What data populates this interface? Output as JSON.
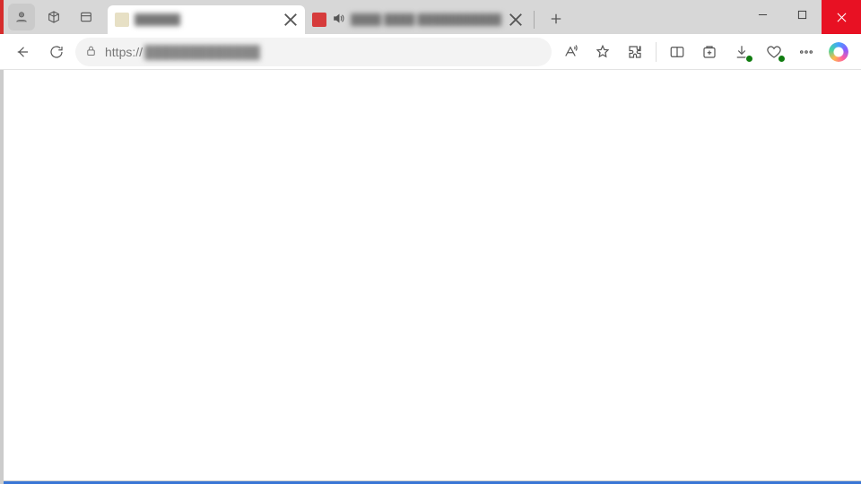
{
  "tabs": [
    {
      "title": "██████",
      "favicon_color": "#e7e0c5",
      "active": true,
      "has_audio": false
    },
    {
      "title": "████ ████ ███████████",
      "favicon_color": "#d63b3b",
      "active": false,
      "has_audio": true
    }
  ],
  "address_bar": {
    "scheme": "https://",
    "rest": "█████████████"
  },
  "window_controls": {
    "minimize": "Minimize",
    "maximize": "Maximize",
    "close": "Close"
  },
  "toolbar": {
    "back": "Back",
    "refresh": "Refresh",
    "read_aloud": "Read aloud",
    "favorite": "Add to favorites",
    "extensions": "Extensions",
    "split": "Split screen",
    "collections": "Collections",
    "downloads": "Downloads",
    "performance": "Browser essentials",
    "more": "Settings and more",
    "copilot": "Copilot"
  },
  "titlebar": {
    "profile": "Profile",
    "workspaces": "Workspaces",
    "tab_actions": "Tab actions",
    "new_tab": "New tab"
  }
}
